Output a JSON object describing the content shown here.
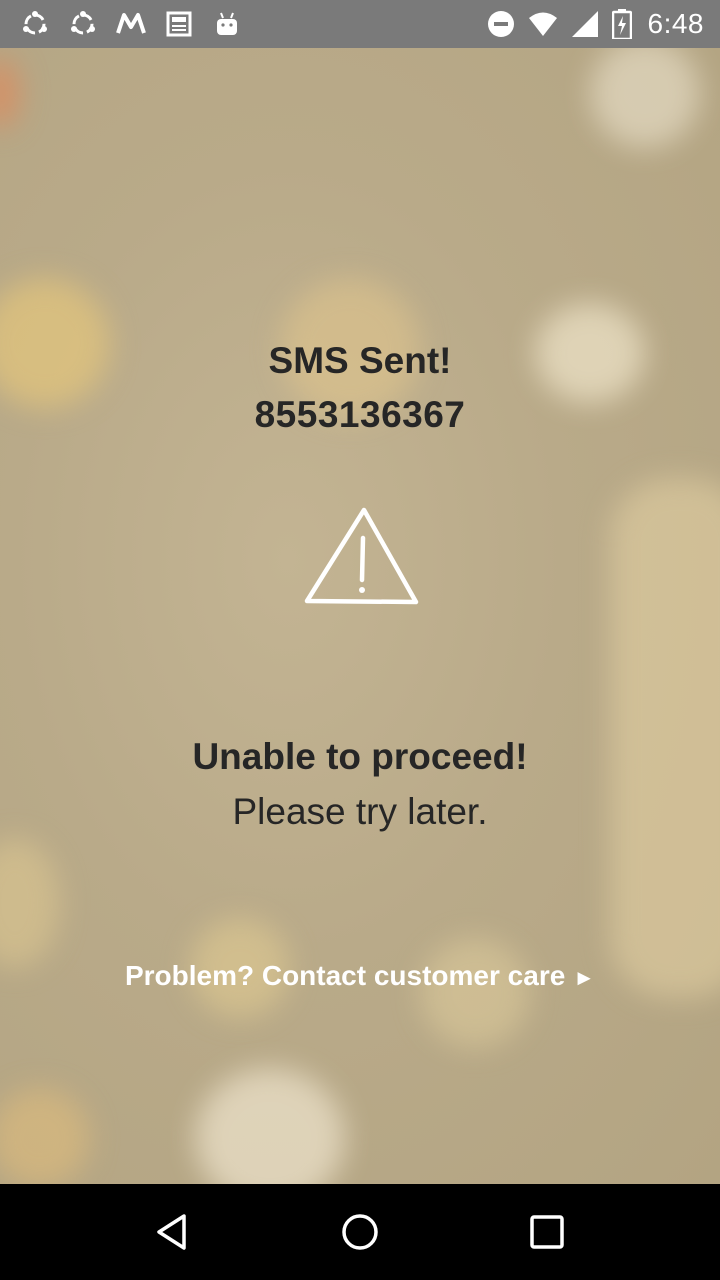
{
  "status_bar": {
    "left_icons": [
      "share-it-icon",
      "share-it-icon",
      "myntra-icon",
      "news-icon",
      "android-icon"
    ],
    "right_icons": [
      "do-not-disturb-icon",
      "wifi-icon",
      "cell-signal-icon",
      "battery-charging-icon"
    ],
    "time": "6:48"
  },
  "screen": {
    "sms_title": "SMS Sent!",
    "phone_number": "8553136367",
    "error_title": "Unable to proceed!",
    "error_subtitle": "Please try later.",
    "contact_link": "Problem? Contact customer care",
    "contact_arrow": "►"
  },
  "nav_bar": {
    "buttons": [
      "back-icon",
      "home-icon",
      "recents-icon"
    ]
  },
  "colors": {
    "status_bar": "#7a7a7a",
    "background": "#b9aa89",
    "text_dark": "#262626",
    "link_text": "#ffffff"
  }
}
